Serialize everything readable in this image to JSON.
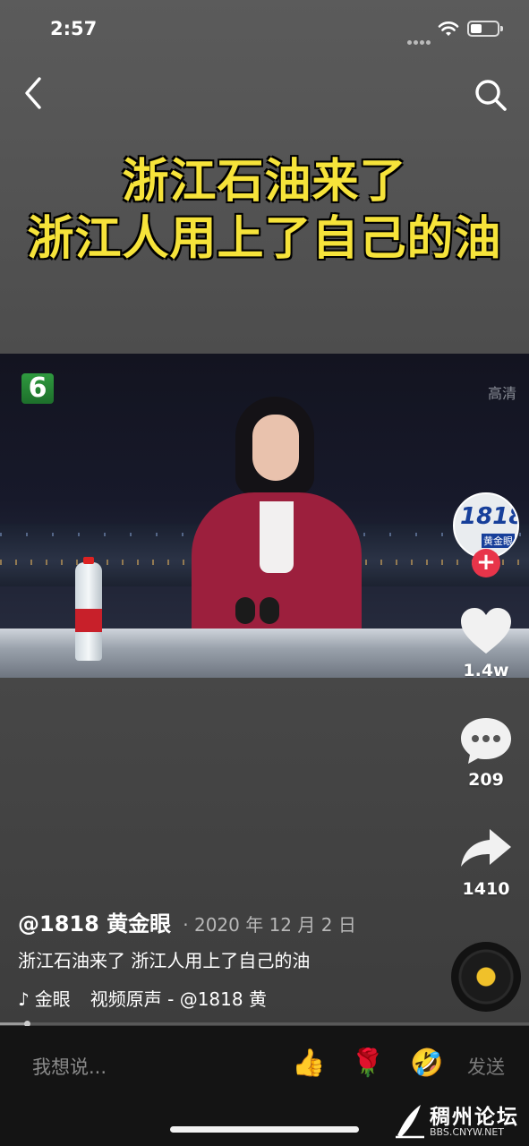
{
  "status_bar": {
    "time": "2:57"
  },
  "video": {
    "title_line1": "浙江石油来了",
    "title_line2": "浙江人用上了自己的油",
    "channel_badge": "6",
    "quality_label": "高清"
  },
  "creator": {
    "avatar_text": "1818",
    "avatar_sub": "黄金眼"
  },
  "actions": {
    "likes": "1.4w",
    "comments": "209",
    "shares": "1410"
  },
  "post": {
    "author": "@1818 黄金眼",
    "date": "· 2020 年 12 月 2 日",
    "caption": "浙江石油来了 浙江人用上了自己的油",
    "music_user": "金眼",
    "music_title": "视频原声 - @1818 黄"
  },
  "comment_bar": {
    "placeholder": "我想说...",
    "emojis": [
      "👍",
      "🌹",
      "🤣"
    ],
    "send_label": "发送"
  },
  "watermark": {
    "name": "稠州论坛",
    "url": "BBS.CNYW.NET"
  },
  "icons": {
    "back": "chevron-left-icon",
    "search": "search-icon",
    "like": "heart-icon",
    "comment": "speech-bubble-icon",
    "share": "share-arrow-icon",
    "music": "music-note-icon"
  },
  "colors": {
    "title_yellow": "#f6e33a",
    "follow_red": "#e8344a",
    "disc_center": "#f0c12a"
  }
}
